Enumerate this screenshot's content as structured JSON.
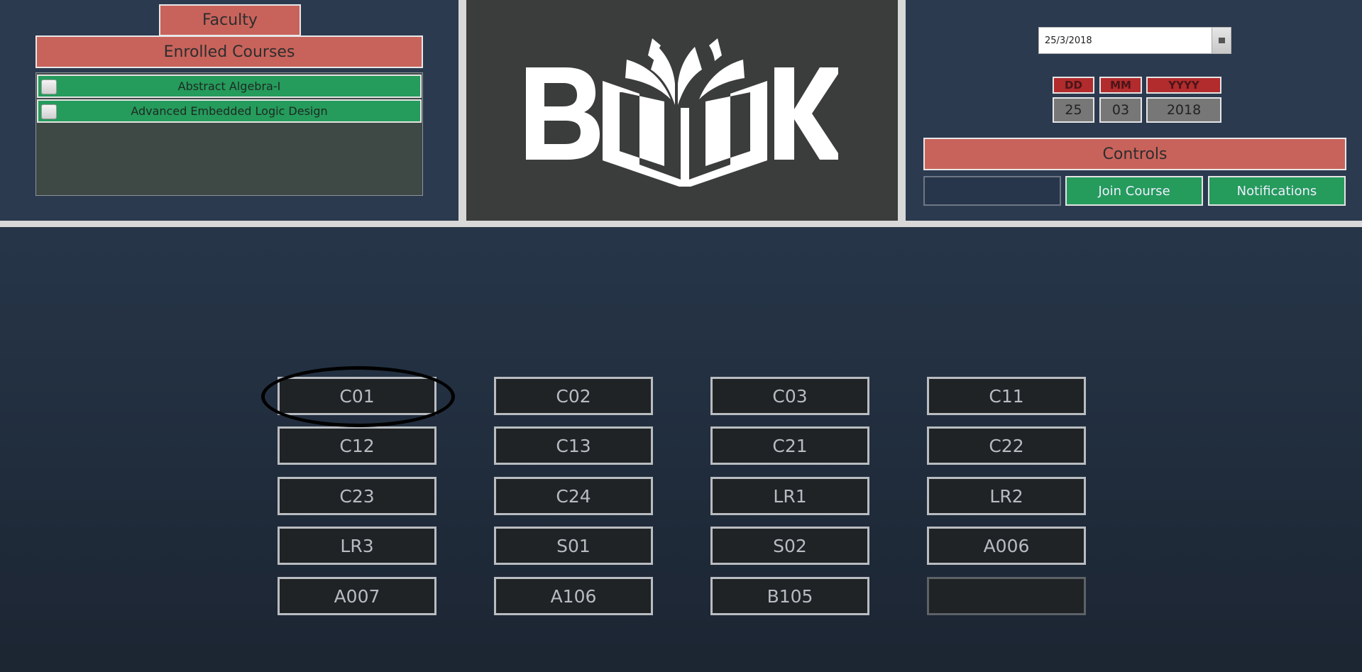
{
  "left_panel": {
    "faculty_tab": "Faculty",
    "enrolled_header": "Enrolled Courses",
    "courses": [
      {
        "name": "Abstract Algebra-I",
        "checked": false
      },
      {
        "name": "Advanced Embedded Logic Design",
        "checked": false
      }
    ]
  },
  "logo": {
    "text": "BOOK",
    "color": "#ffffff"
  },
  "right_panel": {
    "date_value": "25/3/2018",
    "labels": {
      "dd": "DD",
      "mm": "MM",
      "yyyy": "YYYY"
    },
    "values": {
      "dd": "25",
      "mm": "03",
      "yyyy": "2018"
    },
    "controls_header": "Controls",
    "input_value": "",
    "join_button": "Join Course",
    "notifications_button": "Notifications"
  },
  "rooms": [
    "C01",
    "C02",
    "C03",
    "C11",
    "C12",
    "C13",
    "C21",
    "C22",
    "C23",
    "C24",
    "LR1",
    "LR2",
    "LR3",
    "S01",
    "S02",
    "A006",
    "A007",
    "A106",
    "B105",
    ""
  ],
  "highlighted_room": "C01",
  "colors": {
    "header_red": "#c8635b",
    "course_green": "#259b5c",
    "date_label_red": "#b22b2d",
    "room_bg": "#202326"
  }
}
